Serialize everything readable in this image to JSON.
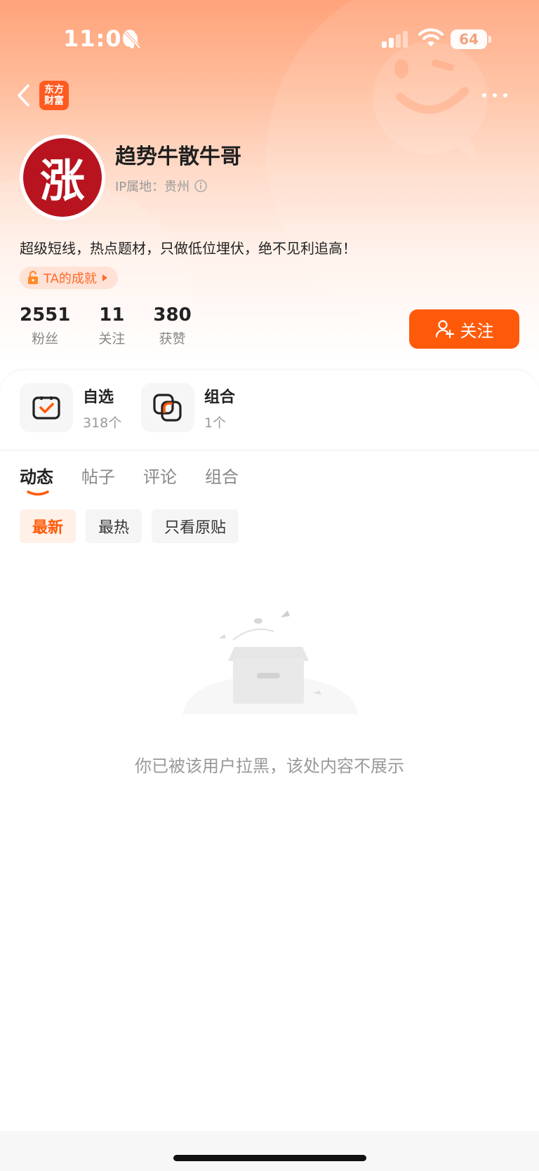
{
  "status_bar": {
    "time": "11:00",
    "battery": "64"
  },
  "header": {
    "app_logo_line1": "东方",
    "app_logo_line2": "财富"
  },
  "profile": {
    "avatar_text": "涨",
    "name": "趋势牛散牛哥",
    "ip_location": "IP属地：贵州",
    "bio": "超级短线，热点题材，只做低位埋伏，绝不见利追高！",
    "badge": "TA的成就",
    "stats": [
      {
        "value": "2551",
        "label": "粉丝"
      },
      {
        "value": "11",
        "label": "关注"
      },
      {
        "value": "380",
        "label": "获赞"
      }
    ],
    "follow_label": "关注"
  },
  "shortcuts": [
    {
      "title": "自选",
      "sub": "318个",
      "icon": "watchlist-check-icon"
    },
    {
      "title": "组合",
      "sub": "1个",
      "icon": "portfolio-combo-icon"
    }
  ],
  "tabs": [
    {
      "label": "动态",
      "active": true
    },
    {
      "label": "帖子",
      "active": false
    },
    {
      "label": "评论",
      "active": false
    },
    {
      "label": "组合",
      "active": false
    }
  ],
  "filters": [
    {
      "label": "最新",
      "active": true
    },
    {
      "label": "最热",
      "active": false
    },
    {
      "label": "只看原贴",
      "active": false
    }
  ],
  "empty_message": "你已被该用户拉黑，该处内容不展示",
  "colors": {
    "accent": "#ff5a0a",
    "avatar_bg": "#b8141f"
  }
}
